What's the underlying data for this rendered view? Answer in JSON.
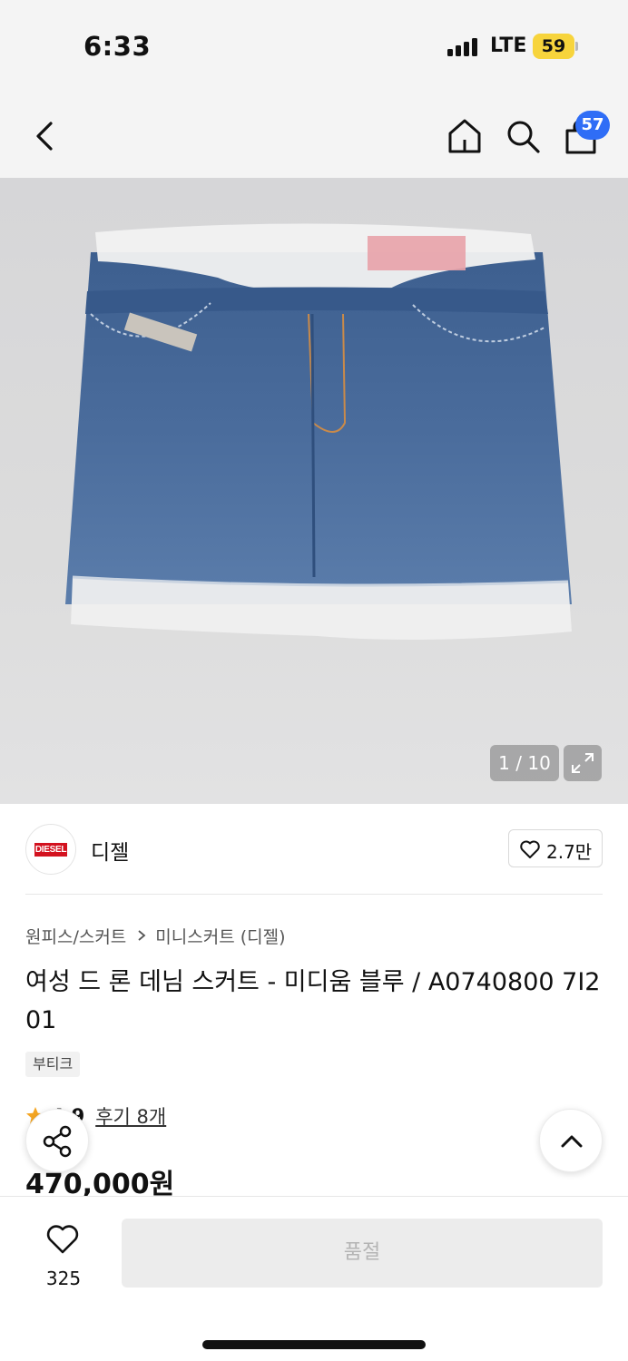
{
  "status_bar": {
    "time": "6:33",
    "network": "LTE",
    "battery": "59"
  },
  "header": {
    "back_icon": "chevron-left-icon",
    "home_icon": "home-icon",
    "search_icon": "search-icon",
    "cart_icon": "shopping-bag-icon",
    "cart_count": "57"
  },
  "gallery": {
    "counter": "1 / 10",
    "expand_icon": "expand-icon"
  },
  "brand": {
    "logo_text": "DIESEL",
    "name": "디젤",
    "like_count": "2.7만"
  },
  "breadcrumb": {
    "category": "원피스/스커트",
    "subcategory": "미니스커트 (디젤)"
  },
  "product": {
    "title": "여성 드 론 데님 스커트 - 미디움 블루 / A0740800 7I201",
    "tag": "부티크",
    "rating": "4.9",
    "reviews": "후기 8개",
    "price": "470,000원"
  },
  "bottom_bar": {
    "wish_count": "325",
    "soldout_label": "품절"
  },
  "colors": {
    "accent_blue": "#2f6df6",
    "battery_yellow": "#f7d43c",
    "brand_red": "#d3121f",
    "star_orange": "#f5a623"
  }
}
